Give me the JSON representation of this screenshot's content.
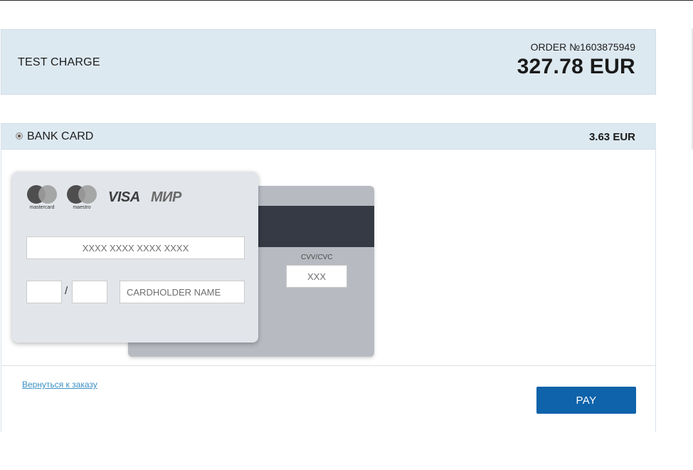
{
  "order": {
    "title": "TEST CHARGE",
    "number_label": "ORDER №1603875949",
    "amount": "327.78 EUR"
  },
  "payment_method": {
    "label": "BANK CARD",
    "amount": "3.63 EUR",
    "selected": true
  },
  "brands": [
    {
      "name": "mastercard",
      "icon": "mastercard-logo"
    },
    {
      "name": "maestro",
      "icon": "maestro-logo"
    },
    {
      "name": "VISA",
      "icon": "visa-logo"
    },
    {
      "name": "МИР",
      "icon": "mir-logo"
    }
  ],
  "card_form": {
    "card_number_placeholder": "XXXX XXXX XXXX XXXX",
    "expiry_separator": "/",
    "cardholder_placeholder": "CARDHOLDER NAME",
    "cvv_label": "CVV/CVC",
    "cvv_placeholder": "XXX"
  },
  "footer": {
    "back_link": "Вернуться к заказу",
    "pay_label": "PAY"
  },
  "colors": {
    "header_bg": "#dde9f1",
    "pay_button": "#0e63aa",
    "link": "#3b8fc4",
    "card_front": "#e2e6ea",
    "card_back": "#b7bbc1",
    "mag_stripe": "#353a44"
  }
}
